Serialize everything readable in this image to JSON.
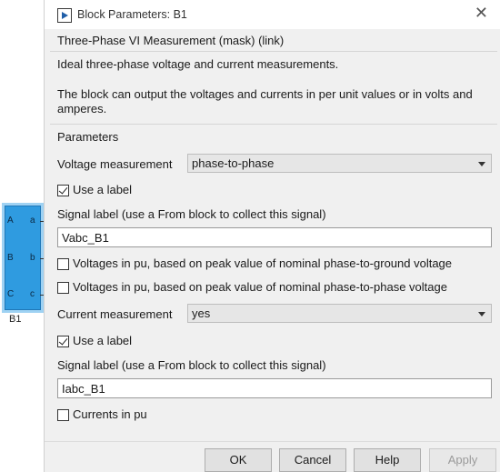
{
  "block": {
    "name": "B1",
    "ports_in": [
      "A",
      "B",
      "C"
    ],
    "ports_out": [
      "a",
      "b",
      "c"
    ],
    "color": "#2f9be0"
  },
  "dialog": {
    "title": "Block Parameters: B1",
    "header": "Three-Phase VI Measurement (mask) (link)",
    "desc1": "Ideal three-phase voltage and current measurements.",
    "desc2": "The block can output the voltages and currents in per unit values or in volts and amperes.",
    "parameters_label": "Parameters",
    "voltage": {
      "label": "Voltage measurement",
      "value": "phase-to-phase",
      "use_label_text": "Use a label",
      "use_label_checked": true,
      "signal_label_text": "Signal label  (use a From block to collect this signal)",
      "signal_value": "Vabc_B1",
      "pu_ground_text": "Voltages in pu,  based on peak value of nominal phase-to-ground voltage",
      "pu_ground_checked": false,
      "pu_phase_text": "Voltages in pu,  based on peak value of nominal phase-to-phase  voltage",
      "pu_phase_checked": false
    },
    "current": {
      "label": "Current measurement",
      "value": "yes",
      "use_label_text": "Use a label",
      "use_label_checked": true,
      "signal_label_text": "Signal label  (use a From block to collect this signal)",
      "signal_value": "Iabc_B1",
      "pu_text": "Currents in pu",
      "pu_checked": false
    },
    "buttons": {
      "ok": "OK",
      "cancel": "Cancel",
      "help": "Help",
      "apply": "Apply"
    }
  }
}
